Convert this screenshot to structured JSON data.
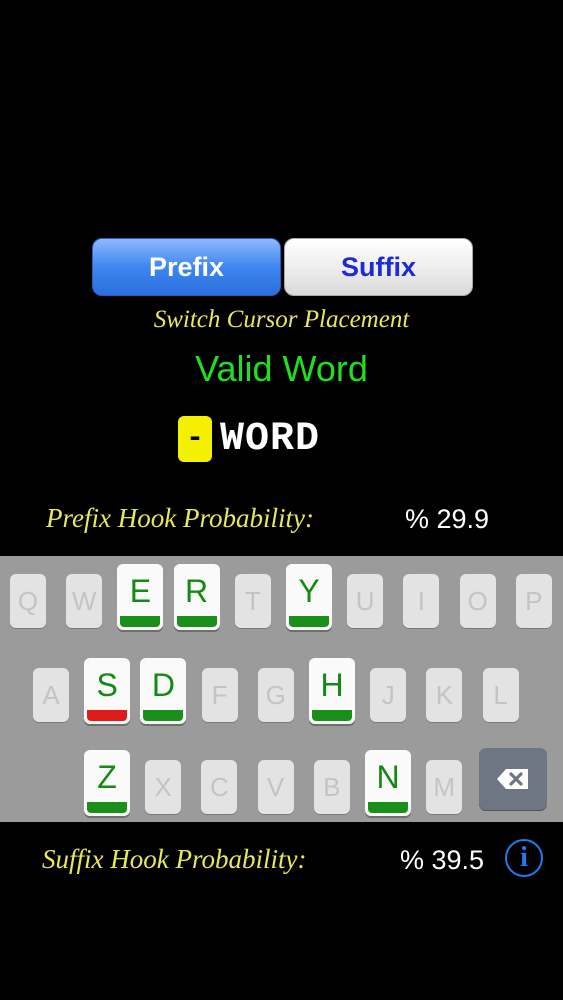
{
  "mode_toggle": {
    "prefix_label": "Prefix",
    "suffix_label": "Suffix",
    "selected": "Prefix"
  },
  "caption": "Switch Cursor Placement",
  "status_text": "Valid Word",
  "word": {
    "cursor_symbol": "-",
    "text": "WORD"
  },
  "prefix_hook": {
    "label": "Prefix Hook Probability:",
    "value": "% 29.9"
  },
  "suffix_hook": {
    "label": "Suffix Hook Probability:",
    "value": "% 39.5"
  },
  "keyboard": {
    "row1": [
      {
        "letter": "Q",
        "active": false
      },
      {
        "letter": "W",
        "active": false
      },
      {
        "letter": "E",
        "active": true,
        "bar": "green"
      },
      {
        "letter": "R",
        "active": true,
        "bar": "green"
      },
      {
        "letter": "T",
        "active": false
      },
      {
        "letter": "Y",
        "active": true,
        "bar": "green"
      },
      {
        "letter": "U",
        "active": false
      },
      {
        "letter": "I",
        "active": false
      },
      {
        "letter": "O",
        "active": false
      },
      {
        "letter": "P",
        "active": false
      }
    ],
    "row2": [
      {
        "letter": "A",
        "active": false
      },
      {
        "letter": "S",
        "active": true,
        "bar": "red"
      },
      {
        "letter": "D",
        "active": true,
        "bar": "green"
      },
      {
        "letter": "F",
        "active": false
      },
      {
        "letter": "G",
        "active": false
      },
      {
        "letter": "H",
        "active": true,
        "bar": "green"
      },
      {
        "letter": "J",
        "active": false
      },
      {
        "letter": "K",
        "active": false
      },
      {
        "letter": "L",
        "active": false
      }
    ],
    "row3": [
      {
        "letter": "Z",
        "active": true,
        "bar": "green"
      },
      {
        "letter": "X",
        "active": false
      },
      {
        "letter": "C",
        "active": false
      },
      {
        "letter": "V",
        "active": false
      },
      {
        "letter": "B",
        "active": false
      },
      {
        "letter": "N",
        "active": true,
        "bar": "green"
      },
      {
        "letter": "M",
        "active": false
      }
    ],
    "backspace_icon": "backspace-icon"
  },
  "info_icon": "info-icon",
  "colors": {
    "background": "#000000",
    "caption_yellow": "#e8e85a",
    "valid_green": "#1fe01f",
    "key_green": "#138a13",
    "bar_red": "#e01b1b",
    "selected_blue": "#3f86ef",
    "suffix_text_blue": "#1c2bd6",
    "cursor_yellow": "#f5f000"
  }
}
